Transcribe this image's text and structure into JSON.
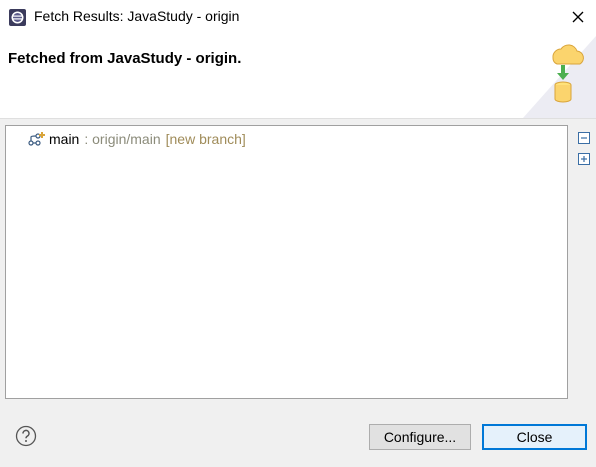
{
  "window": {
    "title": "Fetch Results: JavaStudy - origin",
    "app_icon": "eclipse-icon",
    "close_icon": "close-icon"
  },
  "header": {
    "title": "Fetched from JavaStudy - origin.",
    "icon": "fetch-wizard-icon"
  },
  "results": {
    "items": [
      {
        "icon": "new-branch-icon",
        "local_ref": "main",
        "remote_ref": ": origin/main",
        "mode": "[new branch]"
      }
    ]
  },
  "side_toolbar": {
    "collapse_icon": "collapse-all-icon",
    "expand_icon": "expand-all-icon"
  },
  "footer": {
    "help_icon": "help-icon",
    "configure_label": "Configure...",
    "close_label": "Close"
  },
  "colors": {
    "accent": "#0078d7",
    "remote_ref": "#8b8b7a",
    "mode": "#a08c5a"
  }
}
